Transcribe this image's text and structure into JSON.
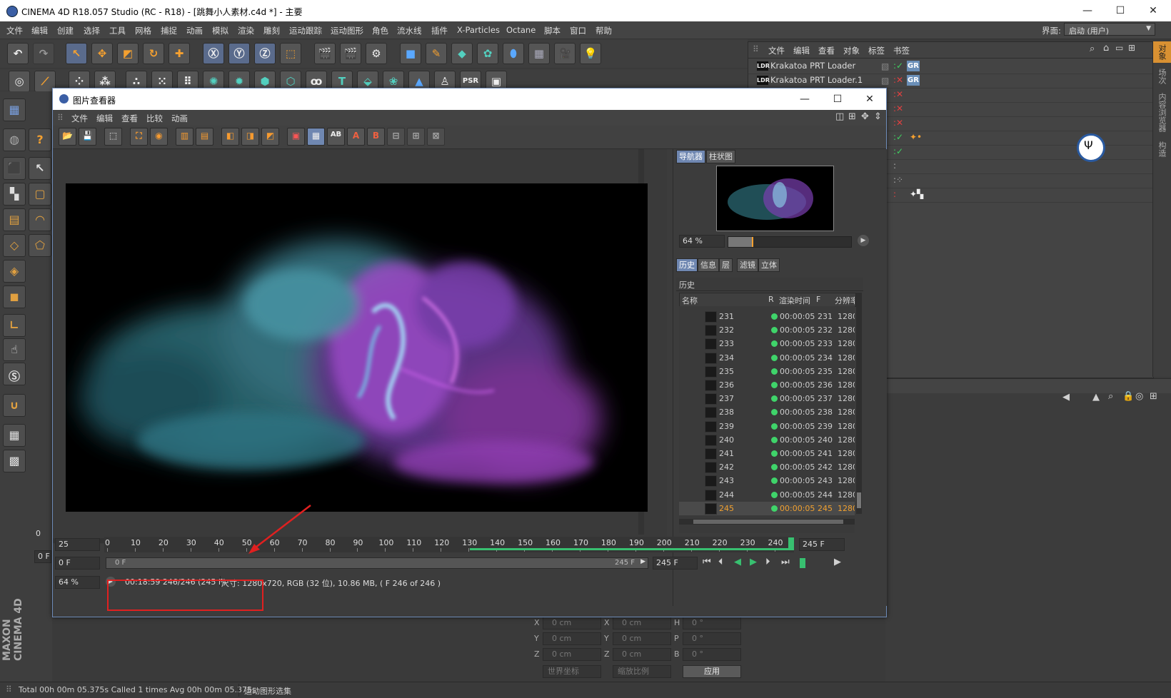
{
  "app": {
    "title": "CINEMA 4D R18.057 Studio (RC - R18) - [跳舞小人素材.c4d *] - 主要",
    "interface_label": "界面:",
    "interface_value": "启动 (用户)",
    "brand": "MAXON CINEMA 4D"
  },
  "menu": [
    "文件",
    "编辑",
    "创建",
    "选择",
    "工具",
    "网格",
    "捕捉",
    "动画",
    "模拟",
    "渲染",
    "雕刻",
    "运动跟踪",
    "运动图形",
    "角色",
    "流水线",
    "插件",
    "X-Particles",
    "Octane",
    "脚本",
    "窗口",
    "帮助"
  ],
  "object_manager": {
    "menu": [
      "文件",
      "编辑",
      "查看",
      "对象",
      "标签",
      "书签"
    ],
    "rows": [
      {
        "name": "Krakatoa PRT Loader",
        "tag": "GR"
      },
      {
        "name": "Krakatoa PRT Loader.1",
        "tag": "GR"
      }
    ]
  },
  "right_tabs": [
    "对象",
    "场次",
    "内容浏览器",
    "构造"
  ],
  "viewer": {
    "title": "图片查看器",
    "menu": [
      "文件",
      "编辑",
      "查看",
      "比较",
      "动画"
    ],
    "side_tabs_top": [
      "导航器",
      "柱状图"
    ],
    "zoom_nav": "64 %",
    "side_tabs_bottom": [
      "历史",
      "信息",
      "层",
      "滤镜",
      "立体"
    ],
    "history_title": "历史",
    "history_columns": [
      "名称",
      "R",
      "渲染时间",
      "F",
      "分辨率"
    ],
    "history_rows": [
      {
        "name": "231",
        "time": "00:00:05",
        "frame": "231",
        "res": "1280"
      },
      {
        "name": "232",
        "time": "00:00:05",
        "frame": "232",
        "res": "1280"
      },
      {
        "name": "233",
        "time": "00:00:05",
        "frame": "233",
        "res": "1280"
      },
      {
        "name": "234",
        "time": "00:00:05",
        "frame": "234",
        "res": "1280"
      },
      {
        "name": "235",
        "time": "00:00:05",
        "frame": "235",
        "res": "1280"
      },
      {
        "name": "236",
        "time": "00:00:05",
        "frame": "236",
        "res": "1280"
      },
      {
        "name": "237",
        "time": "00:00:05",
        "frame": "237",
        "res": "1280"
      },
      {
        "name": "238",
        "time": "00:00:05",
        "frame": "238",
        "res": "1280"
      },
      {
        "name": "239",
        "time": "00:00:05",
        "frame": "239",
        "res": "1280"
      },
      {
        "name": "240",
        "time": "00:00:05",
        "frame": "240",
        "res": "1280"
      },
      {
        "name": "241",
        "time": "00:00:05",
        "frame": "241",
        "res": "1280"
      },
      {
        "name": "242",
        "time": "00:00:05",
        "frame": "242",
        "res": "1280"
      },
      {
        "name": "243",
        "time": "00:00:05",
        "frame": "243",
        "res": "1280"
      },
      {
        "name": "244",
        "time": "00:00:05",
        "frame": "244",
        "res": "1280"
      },
      {
        "name": "245",
        "time": "00:00:05",
        "frame": "245",
        "res": "1280"
      }
    ],
    "timeline": {
      "fps": "25",
      "ticks": [
        "0",
        "10",
        "20",
        "30",
        "40",
        "50",
        "60",
        "70",
        "80",
        "90",
        "100",
        "110",
        "120",
        "130",
        "140",
        "150",
        "160",
        "170",
        "180",
        "190",
        "200",
        "210",
        "220",
        "230",
        "240"
      ],
      "end_frame": "245 F",
      "start_field": "0 F",
      "range_start": "0 F",
      "range_end": "245 F",
      "range_end_field": "245 F"
    },
    "zoom_bottom": "64 %",
    "status_time": "00:18:59 246/246 (245 F)",
    "status_info": "尺寸: 1280x720, RGB (32 位), 10.86 MB,  ( F 246 of 246 )"
  },
  "attributes": {
    "rows": [
      {
        "a": "X",
        "av": "0 cm",
        "b": "X",
        "bv": "0 cm",
        "c": "H",
        "cv": "0 °"
      },
      {
        "a": "Y",
        "av": "0 cm",
        "b": "Y",
        "bv": "0 cm",
        "c": "P",
        "cv": "0 °"
      },
      {
        "a": "Z",
        "av": "0 cm",
        "b": "Z",
        "bv": "0 cm",
        "c": "B",
        "cv": "0 °"
      }
    ],
    "coord_mode": "世界坐标",
    "scale_mode": "缩放比例",
    "apply": "应用"
  },
  "frame_indicator": "0 F",
  "frame_indicator_top": "0",
  "statusbar": {
    "text": "Total 00h 00m 05.375s Called 1 times Avg 00h 00m 05.375s",
    "mode": "运动图形选集"
  },
  "colors": {
    "accent": "#6f87b1",
    "highlight": "#f0a030",
    "annotation": "#e02020",
    "progress": "#38c070"
  }
}
